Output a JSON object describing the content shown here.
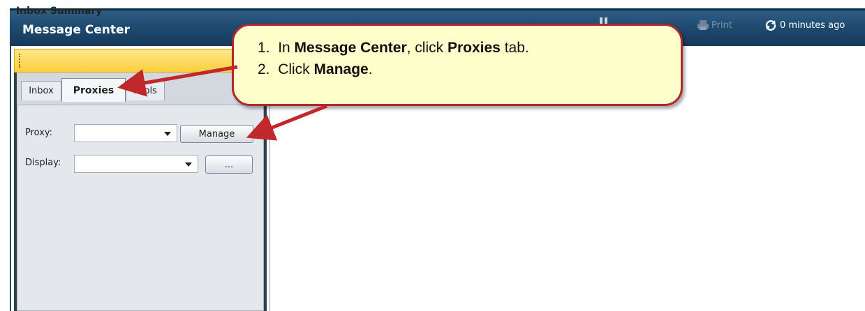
{
  "app": {
    "title": "Message Center"
  },
  "toolbar": {
    "print_label": "Print",
    "refresh_label": "0 minutes ago",
    "icons": {
      "print": "printer-icon",
      "refresh": "refresh-icon"
    }
  },
  "left_panel": {
    "header_title": "Inbox Summary",
    "tabs": [
      {
        "label": "Inbox",
        "selected": false
      },
      {
        "label": "Proxies",
        "selected": true
      },
      {
        "label": "Pools",
        "selected": false
      }
    ],
    "proxy": {
      "label": "Proxy:",
      "value": "",
      "button_label": "Manage"
    },
    "display": {
      "label": "Display:",
      "value": "",
      "button_label": "..."
    }
  },
  "callout": {
    "steps": [
      {
        "num": "1.",
        "parts": [
          "In ",
          "Message Center",
          ", click ",
          "Proxies",
          " tab."
        ]
      },
      {
        "num": "2.",
        "parts": [
          "Click ",
          "Manage",
          "."
        ]
      }
    ]
  },
  "colors": {
    "titlebar": "#1f4a70",
    "header_gold": "#fbcf3a",
    "callout_fill": "#ffffcc",
    "callout_border": "#b1272b",
    "arrow": "#c0282c"
  }
}
